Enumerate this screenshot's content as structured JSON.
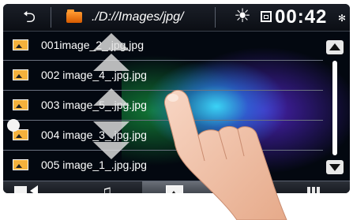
{
  "header": {
    "back_symbol": "⮌",
    "path": "./D://Images/jpg/",
    "brightness_symbol": "☀",
    "time": "00:42",
    "bluetooth_symbol": "✻"
  },
  "files": [
    {
      "name": "001image_2_.jpg.jpg"
    },
    {
      "name": "002 image_4_.jpg.jpg"
    },
    {
      "name": "003 image_5_.jpg.jpg"
    },
    {
      "name": "004 image_3_.jpg.jpg"
    },
    {
      "name": "005 image_1_.jpg.jpg"
    }
  ],
  "bottom_tabs": [
    {
      "icon": "video-icon"
    },
    {
      "icon": "music-icon",
      "symbol": "♫"
    },
    {
      "icon": "photo-icon",
      "active": true
    },
    {
      "icon": "blank"
    },
    {
      "icon": "keypad-icon"
    }
  ],
  "colors": {
    "folder": "#f08a1a",
    "file_icon": "#f5b23c",
    "panel": "#030810"
  }
}
